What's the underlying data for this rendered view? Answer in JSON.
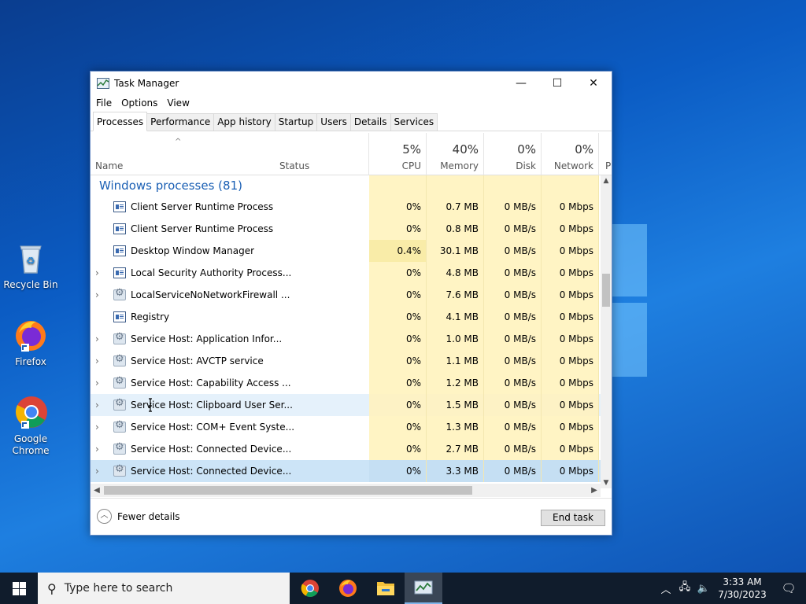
{
  "window": {
    "title": "Task Manager",
    "minimize_glyph": "—",
    "maximize_glyph": "☐",
    "close_glyph": "✕"
  },
  "menu": [
    "File",
    "Options",
    "View"
  ],
  "tabs": [
    {
      "label": "Processes",
      "active": true
    },
    {
      "label": "Performance",
      "active": false
    },
    {
      "label": "App history",
      "active": false
    },
    {
      "label": "Startup",
      "active": false
    },
    {
      "label": "Users",
      "active": false
    },
    {
      "label": "Details",
      "active": false
    },
    {
      "label": "Services",
      "active": false
    }
  ],
  "columns": {
    "name": "Name",
    "status": "Status",
    "cpu": {
      "pct": "5%",
      "label": "CPU"
    },
    "memory": {
      "pct": "40%",
      "label": "Memory"
    },
    "disk": {
      "pct": "0%",
      "label": "Disk"
    },
    "network": {
      "pct": "0%",
      "label": "Network"
    },
    "power": "P"
  },
  "group_header": "Windows processes (81)",
  "processes": [
    {
      "name": "Client Server Runtime Process",
      "icon": "window-icon",
      "expandable": false,
      "cpu": "0%",
      "memory": "0.7 MB",
      "disk": "0 MB/s",
      "network": "0 Mbps"
    },
    {
      "name": "Client Server Runtime Process",
      "icon": "window-icon",
      "expandable": false,
      "cpu": "0%",
      "memory": "0.8 MB",
      "disk": "0 MB/s",
      "network": "0 Mbps"
    },
    {
      "name": "Desktop Window Manager",
      "icon": "window-icon",
      "expandable": false,
      "cpu": "0.4%",
      "memory": "30.1 MB",
      "disk": "0 MB/s",
      "network": "0 Mbps"
    },
    {
      "name": "Local Security Authority Process...",
      "icon": "window-icon",
      "expandable": true,
      "cpu": "0%",
      "memory": "4.8 MB",
      "disk": "0 MB/s",
      "network": "0 Mbps"
    },
    {
      "name": "LocalServiceNoNetworkFirewall ...",
      "icon": "gear-icon",
      "expandable": true,
      "cpu": "0%",
      "memory": "7.6 MB",
      "disk": "0 MB/s",
      "network": "0 Mbps"
    },
    {
      "name": "Registry",
      "icon": "window-icon",
      "expandable": false,
      "cpu": "0%",
      "memory": "4.1 MB",
      "disk": "0 MB/s",
      "network": "0 Mbps"
    },
    {
      "name": "Service Host: Application Infor...",
      "icon": "gear-icon",
      "expandable": true,
      "cpu": "0%",
      "memory": "1.0 MB",
      "disk": "0 MB/s",
      "network": "0 Mbps"
    },
    {
      "name": "Service Host: AVCTP service",
      "icon": "gear-icon",
      "expandable": true,
      "cpu": "0%",
      "memory": "1.1 MB",
      "disk": "0 MB/s",
      "network": "0 Mbps"
    },
    {
      "name": "Service Host: Capability Access ...",
      "icon": "gear-icon",
      "expandable": true,
      "cpu": "0%",
      "memory": "1.2 MB",
      "disk": "0 MB/s",
      "network": "0 Mbps"
    },
    {
      "name": "Service Host: Clipboard User Ser...",
      "icon": "gear-icon",
      "expandable": true,
      "cpu": "0%",
      "memory": "1.5 MB",
      "disk": "0 MB/s",
      "network": "0 Mbps",
      "state": "hover"
    },
    {
      "name": "Service Host: COM+ Event Syste...",
      "icon": "gear-icon",
      "expandable": true,
      "cpu": "0%",
      "memory": "1.3 MB",
      "disk": "0 MB/s",
      "network": "0 Mbps"
    },
    {
      "name": "Service Host: Connected Device...",
      "icon": "gear-icon",
      "expandable": true,
      "cpu": "0%",
      "memory": "2.7 MB",
      "disk": "0 MB/s",
      "network": "0 Mbps"
    },
    {
      "name": "Service Host: Connected Device...",
      "icon": "gear-icon",
      "expandable": true,
      "cpu": "0%",
      "memory": "3.3 MB",
      "disk": "0 MB/s",
      "network": "0 Mbps",
      "state": "selected"
    }
  ],
  "footer": {
    "fewer_details": "Fewer details",
    "end_task": "End task"
  },
  "desktop_icons": [
    {
      "label": "Recycle Bin",
      "icon": "recycle-bin-icon"
    },
    {
      "label": "Firefox",
      "icon": "firefox-icon"
    },
    {
      "label": "Google Chrome",
      "icon": "chrome-icon"
    }
  ],
  "taskbar": {
    "search_placeholder": "Type here to search",
    "apps": [
      "chrome-icon",
      "firefox-icon",
      "file-explorer-icon",
      "task-manager-icon"
    ],
    "time": "3:33 AM",
    "date": "7/30/2023"
  }
}
